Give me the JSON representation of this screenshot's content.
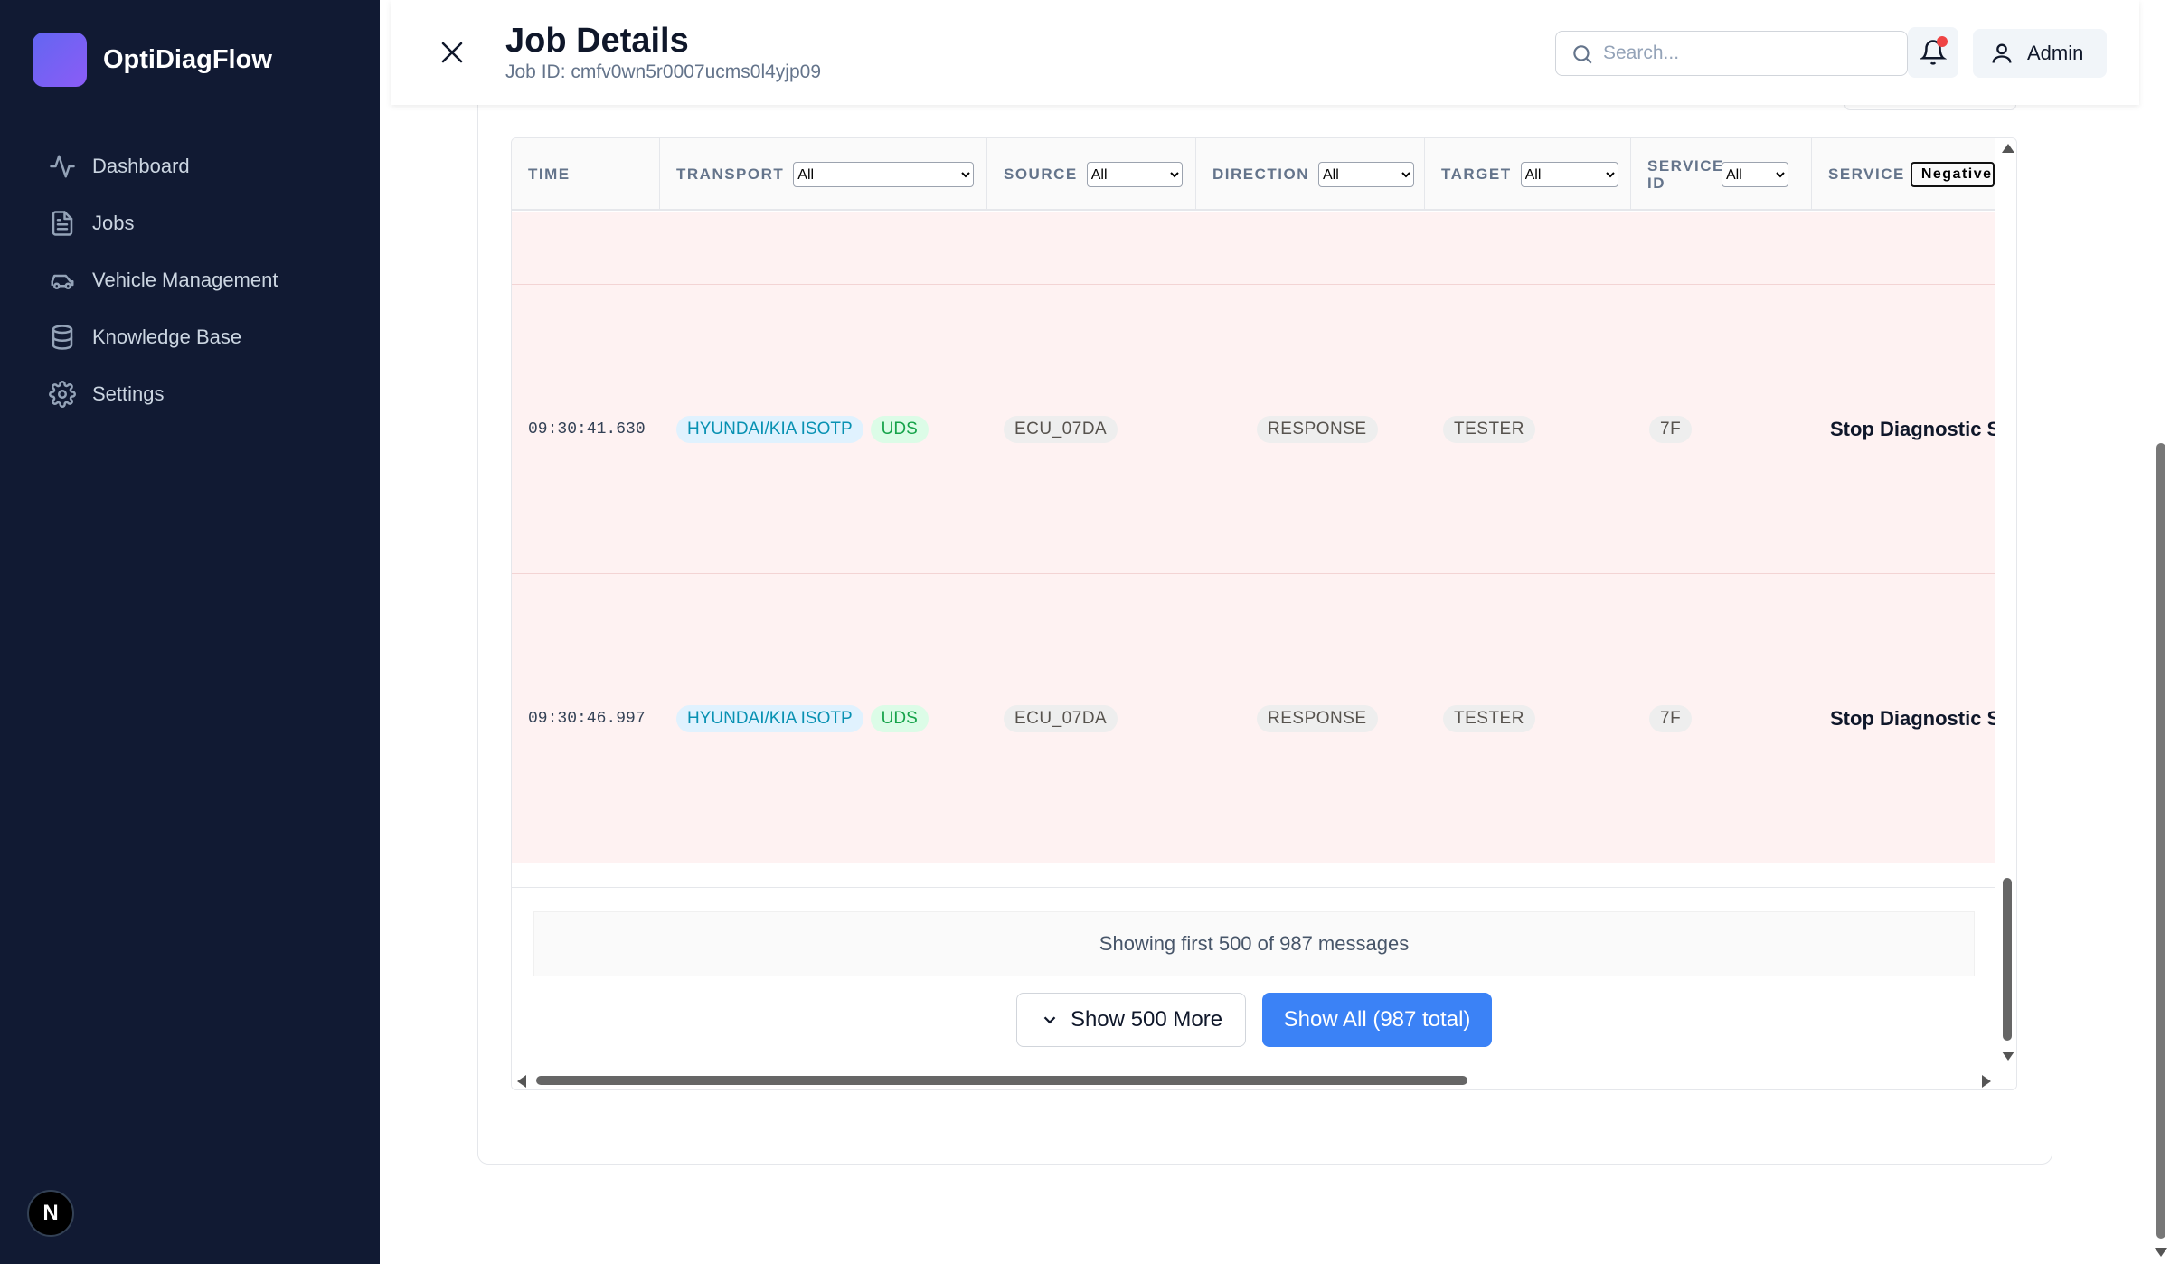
{
  "app": {
    "name": "OptiDiagFlow"
  },
  "sidebar": {
    "items": [
      {
        "label": "Dashboard",
        "icon": "activity-icon"
      },
      {
        "label": "Jobs",
        "icon": "document-icon"
      },
      {
        "label": "Vehicle Management",
        "icon": "car-icon"
      },
      {
        "label": "Knowledge Base",
        "icon": "database-icon"
      },
      {
        "label": "Settings",
        "icon": "gear-icon"
      }
    ],
    "badge": "N"
  },
  "header": {
    "title": "Job Details",
    "job_id": "Job ID: cmfv0wn5r0007ucms0l4yjp09",
    "search_placeholder": "Search...",
    "user_label": "Admin"
  },
  "table": {
    "columns": [
      {
        "label": "TIME"
      },
      {
        "label": "TRANSPORT",
        "filter": "All"
      },
      {
        "label": "SOURCE",
        "filter": "All"
      },
      {
        "label": "DIRECTION",
        "filter": "All"
      },
      {
        "label": "TARGET",
        "filter": "All"
      },
      {
        "label": "SERVICE ID",
        "filter": "All"
      },
      {
        "label": "SERVICE",
        "filter": "Negative Re"
      }
    ],
    "rows": [
      {
        "time": "09:30:41.630",
        "transport": "HYUNDAI/KIA ISOTP",
        "protocol": "UDS",
        "source": "ECU_07DA",
        "direction": "RESPONSE",
        "target": "TESTER",
        "service_id": "7F",
        "service": "Stop Diagnostic Se"
      },
      {
        "time": "09:30:46.997",
        "transport": "HYUNDAI/KIA ISOTP",
        "protocol": "UDS",
        "source": "ECU_07DA",
        "direction": "RESPONSE",
        "target": "TESTER",
        "service_id": "7F",
        "service": "Stop Diagnostic Se"
      }
    ],
    "row_tint": "#fef2f2"
  },
  "pagination": {
    "info": "Showing first 500 of 987 messages",
    "show_more": "Show 500 More",
    "show_all": "Show All (987 total)"
  },
  "colors": {
    "sidebar_bg": "#111a33",
    "primary": "#3b82f6",
    "transport_badge": "#0891b2",
    "protocol_badge": "#16a34a",
    "notification_dot": "#ef4444"
  }
}
